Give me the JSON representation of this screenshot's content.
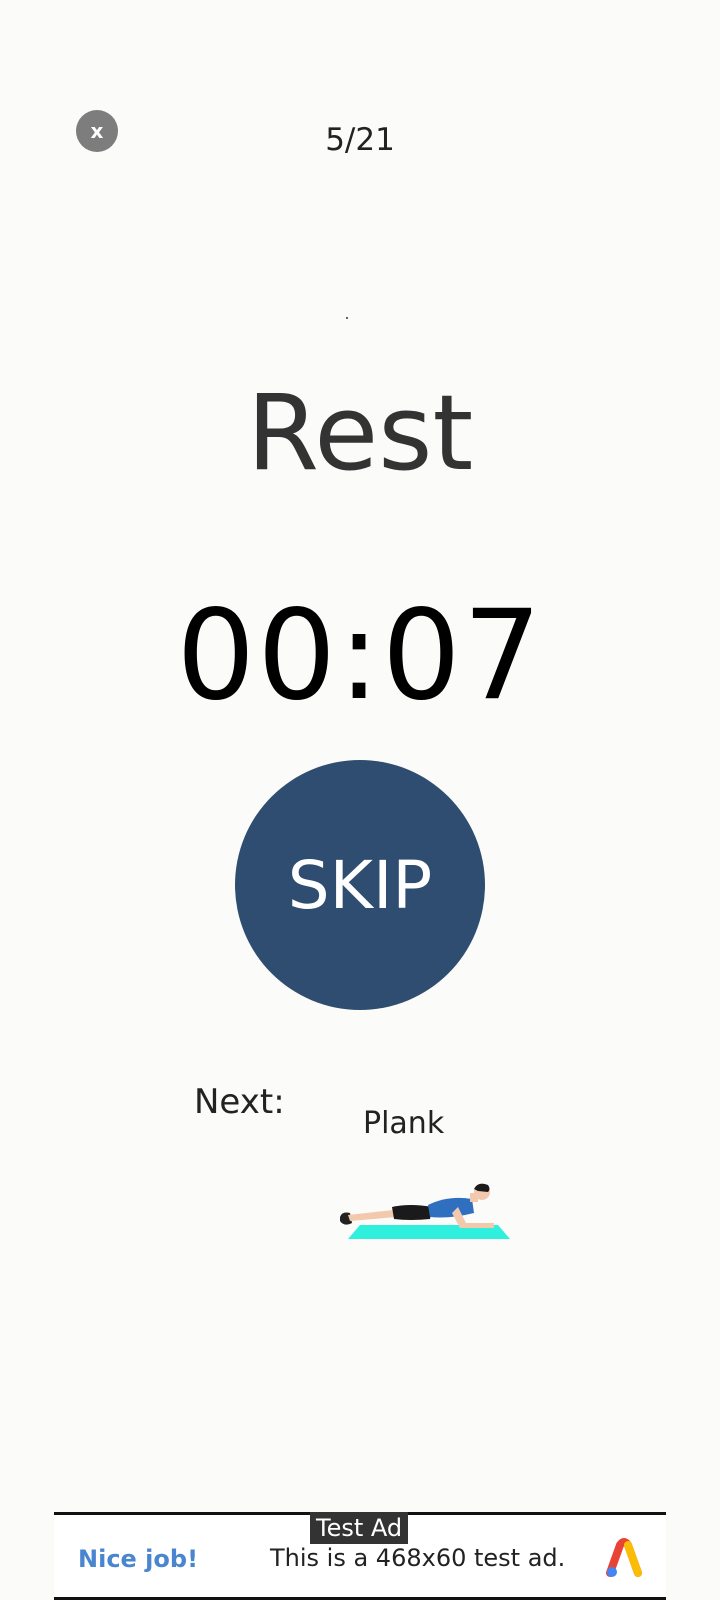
{
  "header": {
    "close_label": "x",
    "progress": "5/21"
  },
  "main": {
    "title": "Rest",
    "timer": "00:07",
    "skip_label": "SKIP",
    "next_label": "Next:",
    "next_exercise": "Plank"
  },
  "ad": {
    "tag": "Test Ad",
    "headline": "Nice job!",
    "body": "This is a 468x60 test ad."
  },
  "colors": {
    "background": "#fbfbf9",
    "skip_button": "#2f4d70",
    "close_button": "#7d7d7d",
    "mat": "#2ef0dc",
    "ad_headline": "#4a86d0"
  },
  "icons": {
    "close": "close-icon",
    "next_exercise": "plank-exercise-illustration",
    "ad_logo": "ads-logo-icon"
  }
}
